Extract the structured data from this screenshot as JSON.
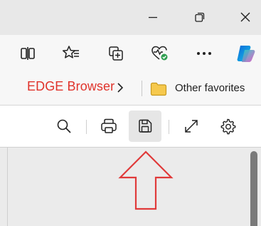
{
  "window": {
    "minimize_icon": "minimize-icon",
    "restore_icon": "restore-icon",
    "close_icon": "close-icon"
  },
  "toolbar": {
    "icons": [
      "split-screen-icon",
      "add-favorite-icon",
      "collections-icon",
      "browser-essentials-icon",
      "more-icon",
      "copilot-icon"
    ]
  },
  "favorites": {
    "items": [
      {
        "label": "EDGE Browser",
        "color": "#e0332b"
      }
    ],
    "other_label": "Other favorites"
  },
  "reader_toolbar": {
    "icons": [
      "search-icon",
      "print-icon",
      "save-icon",
      "fullscreen-icon",
      "settings-icon"
    ]
  },
  "annotation": {
    "arrow_color": "#e03a3a",
    "points_to": "save-icon"
  }
}
